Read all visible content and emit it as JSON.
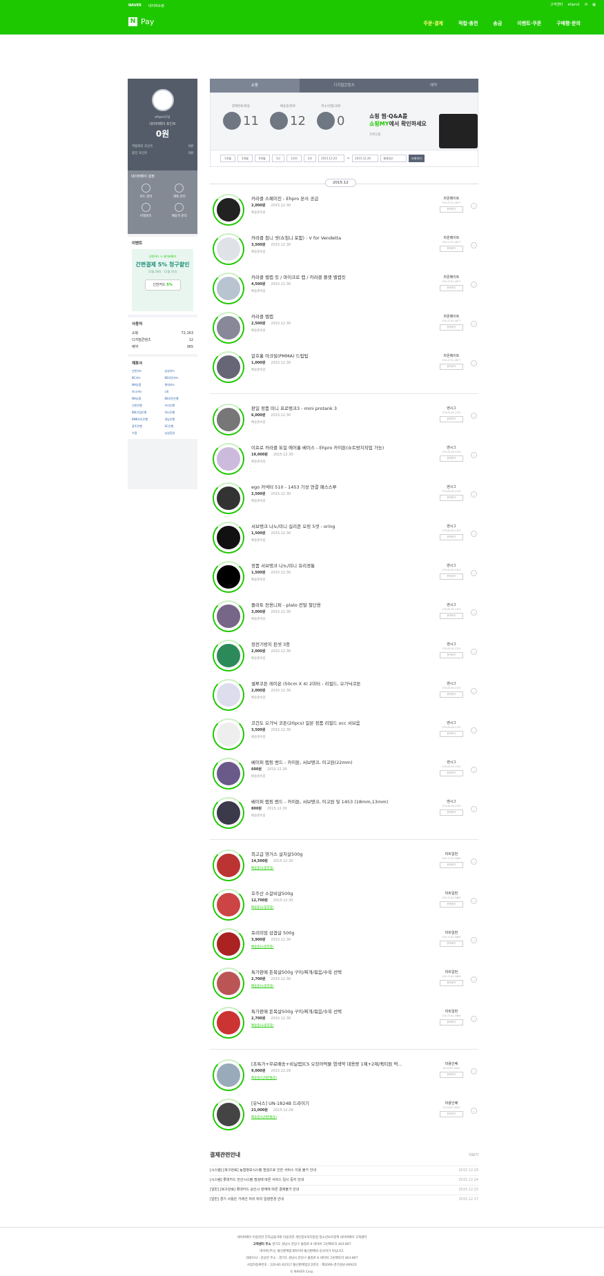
{
  "topbar": {
    "naver": "NAVER",
    "shop": "네이버쇼핑",
    "help": "고객센터",
    "user": "ehpro1",
    "logo": "Pay"
  },
  "gnb": [
    "주문·결제",
    "적립·충전",
    "송금",
    "이벤트·쿠폰",
    "구매평·문의"
  ],
  "profile": {
    "nick": "ehpro1님",
    "name": "네이버페이 포인트",
    "points": "0원",
    "row1": "적립예정 포인트",
    "row1v": "0원",
    "row2": "충전 포인트",
    "row2v": "0원"
  },
  "manage": {
    "title": "네이버페이 설정",
    "items": [
      "카드 관리",
      "계좌 관리",
      "비밀번호",
      "배송지 관리"
    ]
  },
  "event": {
    "title": "이벤트",
    "t1": "신한카드 × 네이버페이",
    "t2": "간편결제 5% 청구할인",
    "t3": "12월 28일 - 12월 31일",
    "card": "신한카드",
    "pct": "5%"
  },
  "usage": {
    "title": "사용처",
    "rows": [
      {
        "k": "쇼핑",
        "v": "72,163"
      },
      {
        "k": "디지털콘텐츠",
        "v": "12"
      },
      {
        "k": "예약",
        "v": "365"
      }
    ]
  },
  "partners": {
    "title": "제휴사",
    "list": [
      "신한카드",
      "삼성카드",
      "BC카드",
      "KB국민카드",
      "NH농협",
      "롯데카드",
      "하나카드",
      "citi",
      "NH농협",
      "KB국민은행",
      "신한은행",
      "우리은행",
      "IBK기업은행",
      "하나은행",
      "BNK부산은행",
      "경남은행",
      "광주은행",
      "SC은행",
      "수협",
      "삼성증권"
    ]
  },
  "tabs": [
    "쇼핑",
    "디지털콘텐츠",
    "예약"
  ],
  "summary": [
    {
      "label": "결제완료/발송",
      "num": "11"
    },
    {
      "label": "배송중/완료",
      "num": "12"
    },
    {
      "label": "취소/반품/교환",
      "num": "0"
    }
  ],
  "promo": {
    "l1": "쇼핑 찜·Q&A를",
    "l2a": "쇼핑MY",
    "l2b": "에서 확인하세요",
    "sub": "전체상품"
  },
  "filter": {
    "periods": [
      "1개월",
      "3개월",
      "6개월",
      "1년",
      "1년전",
      "2년"
    ],
    "from": "2015.12.20",
    "to": "2015.12.20",
    "sel": "결제일순",
    "go": "조회하기"
  },
  "date": "2015.12",
  "groups": [
    {
      "seller": "라온메이트",
      "phone": "010-4751-4677",
      "items": [
        {
          "name": "카라클 스페이진 - Ehpro 본사 공급",
          "price": "2,000원",
          "date": "2015.12.30",
          "status": "배송준비중"
        },
        {
          "name": "카라클 침니 셋(쇼침니 포함) : V for Vendetta",
          "price": "3,500원",
          "date": "2015.12.30",
          "status": "배송준비중"
        },
        {
          "name": "카라클 벨캡 킷 / 마이크로 캡 / 카라클 플랫 벨캡킷",
          "price": "4,500원",
          "date": "2015.12.30",
          "status": "배송준비중"
        },
        {
          "name": "카라클 벨캡",
          "price": "2,500원",
          "date": "2015.12.30",
          "status": "배송준비중"
        },
        {
          "name": "알호홀 아크릴(PMMA) 드립팁",
          "price": "1,000원",
          "date": "2015.12.30",
          "status": "배송준비중"
        }
      ]
    },
    {
      "seller": "엔시그",
      "phone": "070-8116-1323",
      "items": [
        {
          "name": "판일 정품 미니 프로탱크3 - mini protank 3",
          "price": "6,000원",
          "date": "2015.12.30",
          "status": "배송준비중"
        },
        {
          "name": "이프로 카라클 듀얼 에어홀 베이스 - Ehpro 카이툰(쇼트방지작업 가능)",
          "price": "19,000원",
          "date": "2015.12.30",
          "status": "배송준비중"
        },
        {
          "name": "ego 커넥터 510 - 1453 기성 연결 패스스루",
          "price": "2,500원",
          "date": "2015.12.30",
          "status": "배송준비중"
        },
        {
          "name": "서브탱크 나노/미니 실리콘 오링 5셋 - oring",
          "price": "1,500원",
          "date": "2015.12.30",
          "status": "배송준비중"
        },
        {
          "name": "정품 서브탱크 나노/미니 유리경통",
          "price": "1,500원",
          "date": "2015.12.30",
          "status": "배송준비중"
        },
        {
          "name": "플라토 전용니퍼 - plato 컨탈 절단용",
          "price": "3,000원",
          "date": "2015.12.30",
          "status": "배송준비중"
        },
        {
          "name": "정전기방지 핀셋 3종",
          "price": "2,000원",
          "date": "2015.12.30",
          "status": "배송준비중"
        },
        {
          "name": "셀루코튼 레이온 (50cm X 4) 2미터 - 리필드, 오가닉코튼",
          "price": "2,000원",
          "date": "2015.12.30",
          "status": "배송준비중"
        },
        {
          "name": "코건도 오가닉 코튼(20pcs) 일본 정품 리필드 occ 서브옴",
          "price": "3,500원",
          "date": "2015.12.30",
          "status": "배송준비중"
        },
        {
          "name": "베이퍼 랩핑 밴드 - 카이툰, 서브탱크, 이고원(22mm)",
          "price": "600원",
          "date": "2015.12.30",
          "status": "배송준비중"
        },
        {
          "name": "베이퍼 랩핑 밴드 - 카이툰, 서브탱크, 이고원 및 1453 (18mm,13mm)",
          "price": "800원",
          "date": "2015.12.30",
          "status": "배송준비중"
        }
      ]
    },
    {
      "seller": "미트일번",
      "phone": "010-7142-5684",
      "items": [
        {
          "name": "최고급 영거스 살치살500g",
          "price": "14,500원",
          "date": "2015.12.30",
          "status": "배송중(노랑포장)"
        },
        {
          "name": "호주산 소갈비살500g",
          "price": "12,700원",
          "date": "2015.12.30",
          "status": "배송중(노랑포장)"
        },
        {
          "name": "프리미엄 삼겹살 500g",
          "price": "3,900원",
          "date": "2015.12.30",
          "status": "배송중(노랑포장)"
        },
        {
          "name": "특가판매 돈목살500g 구이/찌개/볶음/수육 선택",
          "price": "2,700원",
          "date": "2015.12.30",
          "status": "배송중(노랑포장)"
        },
        {
          "name": "특가판매 돈목살500g 구이/찌개/볶음/수육 선택",
          "price": "2,700원",
          "date": "2015.12.30",
          "status": "배송중(노랑포장)"
        }
      ]
    },
    {
      "seller": "미용인쎄",
      "phone": "02-2057-4501",
      "items": [
        {
          "name": "[초특가+무료배송+비닐캡]CS 오징어먹물 염색약 대용량 1제+2제/퀵티원 먹...",
          "price": "9,000원",
          "date": "2015.12.29",
          "status": "배송중(CJ대한통운)"
        },
        {
          "name": "[유닉스] UN-1824B 드라이기",
          "price": "21,000원",
          "date": "2015.12.29",
          "status": "배송중(CJ대한통운)"
        }
      ]
    }
  ],
  "sellerBtn": "문의하기",
  "notice": {
    "title": "결제관련안내",
    "more": "더보기",
    "rows": [
      {
        "t": "[시스템] [복구완료] 농협정보시스템 점검으로 인한 서비스 이용 불가 안내",
        "d": "2015.12.29"
      },
      {
        "t": "[시스템] 롯데카드 전산시스템 점검에 따른 서비스 일시 중지 안내",
        "d": "2015.12.24"
      },
      {
        "t": "[일반] [복구완료] 롯데카드 승인시 장애에 따른 결제불가 안내",
        "d": "2015.12.22"
      },
      {
        "t": "[일반] 경기 사용은 거래건 처리 처리 일정변경 안내",
        "d": "2015.12.17"
      }
    ]
  },
  "footer": {
    "l1": "네이버페이 이용약관   전자금융거래 이용약관   개인정보처리방침   청소년보호정책   네이버페이 고객센터",
    "l2a": "고객센터 주소",
    "l2b": "경기도 성남시 분당구 불정로 6 네이버 그린팩토리 463-867",
    "l3": "네이버(주)는 통신판매중개자이며 통신판매의 당사자가 아닙니다.",
    "l4": "대표이사 : 김상헌   주소 : 경기도 성남시 분당구 불정로 6 네이버 그린팩토리 463-867",
    "l5": "사업자등록번호 : 220-81-62517   통신판매업신고번호 : 제2006-경기성남-0692호",
    "copy": "© NAVER Corp."
  }
}
